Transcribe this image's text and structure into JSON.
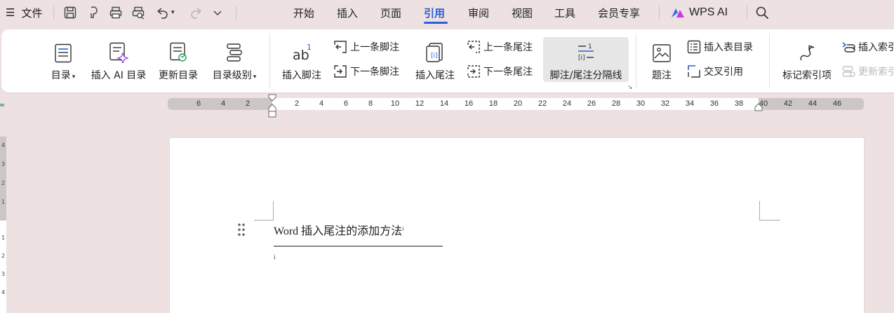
{
  "app": {
    "file_menu": "文件",
    "tabs": [
      "开始",
      "插入",
      "页面",
      "引用",
      "审阅",
      "视图",
      "工具",
      "会员专享"
    ],
    "active_tab": "引用",
    "wps_ai": "WPS AI",
    "accent_color": "#2b5fd9"
  },
  "ribbon": {
    "toc": "目录",
    "insert_ai_toc": "插入 AI 目录",
    "update_toc": "更新目录",
    "toc_level": "目录级别",
    "insert_footnote": "插入脚注",
    "prev_footnote": "上一条脚注",
    "next_footnote": "下一条脚注",
    "insert_endnote": "插入尾注",
    "prev_endnote": "上一条尾注",
    "next_endnote": "下一条尾注",
    "separator": "脚注/尾注分隔线",
    "caption": "题注",
    "insert_figure_toc": "插入表目录",
    "cross_ref": "交叉引用",
    "mark_index": "标记索引项",
    "insert_index": "插入索引",
    "update_index": "更新索引"
  },
  "ruler": {
    "left_ticks": [
      "6",
      "4",
      "2"
    ],
    "right_ticks": [
      "2",
      "4",
      "6",
      "8",
      "10",
      "12",
      "14",
      "16",
      "18",
      "20",
      "22",
      "24",
      "26",
      "28",
      "30",
      "32",
      "34",
      "36",
      "38",
      "40",
      "42",
      "44",
      "46"
    ],
    "vertical_ticks_top": [
      "4",
      "3",
      "2",
      "1"
    ],
    "vertical_ticks_bottom": [
      "1",
      "2",
      "3",
      "4"
    ]
  },
  "document": {
    "title": "Word 插入尾注的添加方法",
    "endnote_ref": "i",
    "endnote_mark": "i"
  }
}
